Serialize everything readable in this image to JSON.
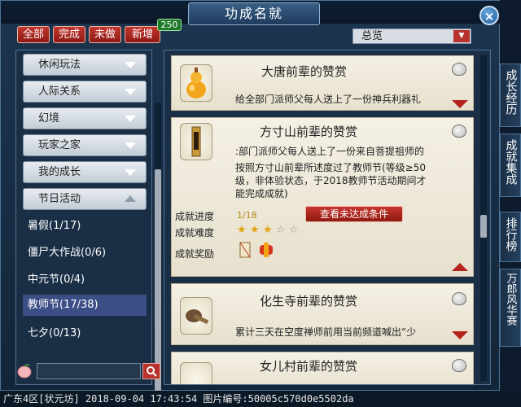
{
  "window": {
    "title": "功成名就",
    "close_icon": "×"
  },
  "tabs": [
    {
      "label": "全部"
    },
    {
      "label": "完成"
    },
    {
      "label": "未做"
    },
    {
      "label": "新增"
    }
  ],
  "new_badge": "250",
  "filter": {
    "selected": "总览"
  },
  "sidebar": {
    "categories": [
      {
        "label": "休闲玩法"
      },
      {
        "label": "人际关系"
      },
      {
        "label": "幻境"
      },
      {
        "label": "玩家之家"
      },
      {
        "label": "我的成长"
      },
      {
        "label": "节日活动"
      }
    ],
    "subitems": [
      {
        "label": "暑假(1/17)"
      },
      {
        "label": "僵尸大作战(0/6)"
      },
      {
        "label": "中元节(0/4)"
      },
      {
        "label": "教师节(17/38)"
      },
      {
        "label": "七夕(0/13)"
      }
    ],
    "active_subitem": "教师节(17/38)"
  },
  "search": {
    "placeholder": "",
    "button_icon": "search-icon"
  },
  "achievements": [
    {
      "title": "大唐前辈的赞赏",
      "desc": "给全部门派师父每人送上了一份神兵利器礼",
      "icon": "gourd-icon"
    },
    {
      "title": "方寸山前辈的赞赏",
      "desc_lines": [
        ":部门派师父每人送上了一份来自菩提祖师的",
        "按照方寸山前辈所述度过了教师节(等级≥50",
        "级，非体验状态，于2018教师节活动期间才",
        "能完成成就)"
      ],
      "icon": "scroll-tablet-icon",
      "progress_label": "成就进度",
      "progress_value": "1/18",
      "difficulty_label": "成就难度",
      "difficulty_stars": 3,
      "difficulty_max": 5,
      "reward_label": "成就奖励",
      "check_button": "查看未达成条件"
    },
    {
      "title": "化生寺前辈的赞赏",
      "desc": "累计三天在空度禅师前用当前频道喊出“少",
      "icon": "mortar-icon"
    },
    {
      "title": "女儿村前辈的赞赏",
      "desc": "",
      "icon": "flower-icon"
    }
  ],
  "right_tabs": [
    {
      "label": "成长经历"
    },
    {
      "label": "成就集成"
    },
    {
      "label": "排行榜"
    },
    {
      "label": "万郎风华赛"
    }
  ],
  "status_bar": "广东4区[状元坊] 2018-09-04 17:43:54 图片编号:50005c570d0e5502da",
  "colors": {
    "accent": "#b7322c",
    "panel": "#1a2f46",
    "card": "#f4f0e4"
  }
}
